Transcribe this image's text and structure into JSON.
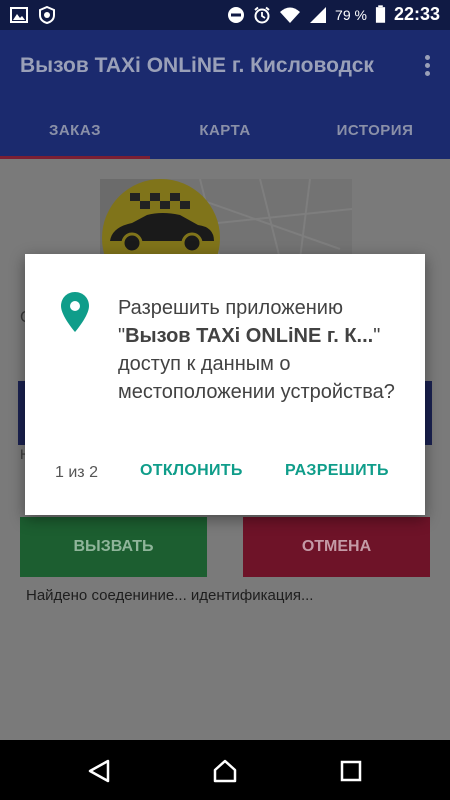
{
  "status_bar": {
    "battery_percent": "79 %",
    "time": "22:33",
    "icons_left": [
      "image-icon",
      "shield-icon"
    ],
    "icons_right": [
      "do-not-disturb-icon",
      "alarm-icon",
      "wifi-icon",
      "signal-icon",
      "battery-icon"
    ]
  },
  "app_bar": {
    "title": "Вызов TAXi ONLiNE г. Кисловодск"
  },
  "tabs": [
    {
      "label": "ЗАКАЗ",
      "active": true
    },
    {
      "label": "КАРТА",
      "active": false
    },
    {
      "label": "ИСТОРИЯ",
      "active": false
    }
  ],
  "main": {
    "partial_text_1": "С",
    "partial_text_2": "Н",
    "call_button": "ВЫЗВАТЬ",
    "cancel_button": "ОТМЕНА",
    "status_text": "Найдено соедениние... идентификация..."
  },
  "dialog": {
    "message_prefix": "Разрешить приложению \"",
    "app_name": "Вызов TAXi ONLiNE г. К...",
    "message_suffix": "\" доступ к данным о местоположении устройства?",
    "counter": "1 из 2",
    "deny_label": "ОТКЛОНИТЬ",
    "allow_label": "РАЗРЕШИТЬ"
  },
  "colors": {
    "accent": "#0f9d8a",
    "primary": "#1b2a6e",
    "call": "#1c5e30",
    "cancel": "#6e1328"
  }
}
